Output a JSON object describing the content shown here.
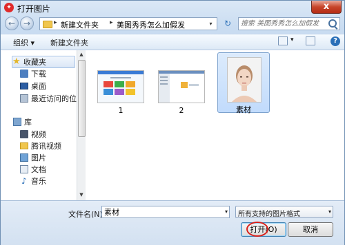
{
  "window": {
    "title": "打开图片",
    "app_icon": "meitu-app-icon",
    "close_glyph": "x"
  },
  "nav": {
    "back_glyph": "←",
    "forward_glyph": "→",
    "breadcrumbs": [
      "新建文件夹",
      "美图秀秀怎么加假发"
    ],
    "crumb_separator": "▸",
    "dropdown_glyph": "▾",
    "refresh_glyph": "↻",
    "search_placeholder": "搜索 美图秀秀怎么加假发"
  },
  "toolbar": {
    "organize_label": "组织 ▾",
    "new_folder_label": "新建文件夹",
    "view_dropdown_glyph": "▾",
    "help_glyph": "?"
  },
  "sidebar": {
    "favorites": {
      "label": "收藏夹",
      "items": [
        {
          "label": "下载",
          "icon": "download-folder-icon"
        },
        {
          "label": "桌面",
          "icon": "desktop-icon"
        },
        {
          "label": "最近访问的位置",
          "icon": "recent-places-icon"
        }
      ]
    },
    "libraries": {
      "label": "库",
      "items": [
        {
          "label": "视频",
          "icon": "video-library-icon"
        },
        {
          "label": "腾讯视频",
          "icon": "folder-icon"
        },
        {
          "label": "图片",
          "icon": "pictures-library-icon"
        },
        {
          "label": "文档",
          "icon": "documents-library-icon"
        },
        {
          "label": "音乐",
          "icon": "music-library-icon"
        }
      ]
    },
    "scroll_up_glyph": "▲",
    "scroll_down_glyph": "▼"
  },
  "files": [
    {
      "name": "1",
      "selected": false
    },
    {
      "name": "2",
      "selected": false
    },
    {
      "name": "素材",
      "selected": true
    }
  ],
  "bottom": {
    "filename_label": "文件名(N):",
    "filename_value": "素材",
    "filter_value": "所有支持的图片格式",
    "dropdown_glyph": "▾",
    "open_label": "打开(O)",
    "cancel_label": "取消"
  },
  "colors": {
    "accent": "#2a6fb8",
    "selection": "#c1dbfc",
    "annotation_ring": "#d8201a"
  }
}
